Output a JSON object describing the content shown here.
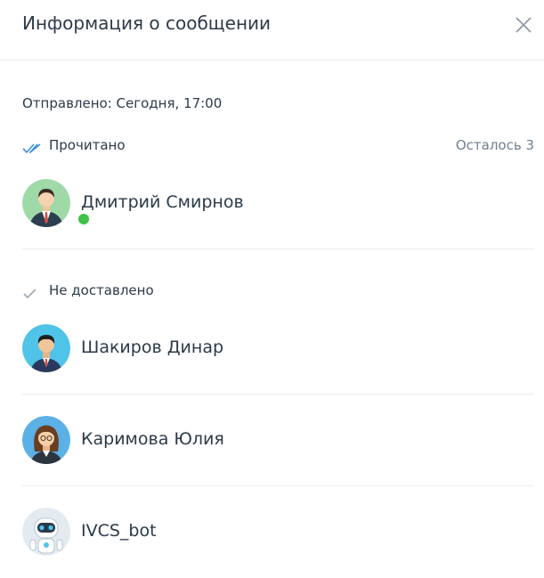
{
  "dialog": {
    "title": "Информация о сообщении",
    "sent": "Отправлено: Сегодня, 17:00",
    "read_section": {
      "label": "Прочитано",
      "remaining": "Осталось 3",
      "users": [
        {
          "name": "Дмитрий Смирнов",
          "avatar_icon": "businessman-avatar-icon",
          "online": true
        }
      ]
    },
    "undelivered_section": {
      "label": "Не доставлено",
      "users": [
        {
          "name": "Шакиров Динар",
          "avatar_icon": "man-avatar-icon"
        },
        {
          "name": "Каримова Юлия",
          "avatar_icon": "woman-avatar-icon"
        },
        {
          "name": "IVCS_bot",
          "avatar_icon": "robot-avatar-icon"
        }
      ]
    }
  },
  "colors": {
    "read_check": "#3f8fdc",
    "delivered_check": "#9aa6b2",
    "online": "#3fc14a",
    "text": "#2b3a4a",
    "muted": "#6f7f90"
  }
}
